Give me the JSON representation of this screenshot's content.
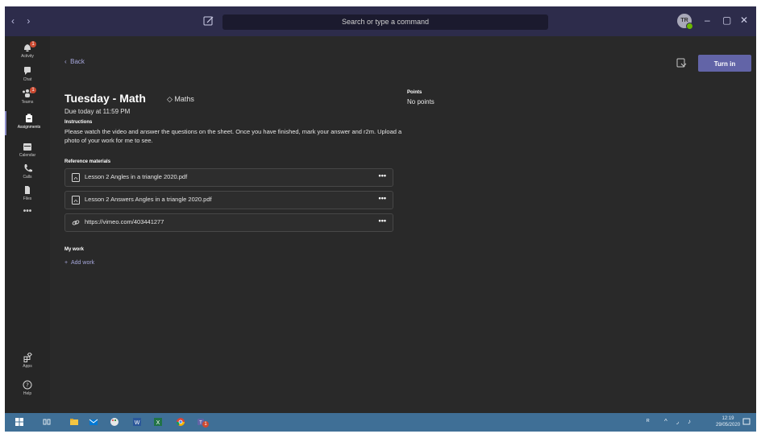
{
  "titlebar": {
    "nav_arrows": "‹ ›",
    "search_placeholder": "Search or type a command",
    "avatar_initials": "TR",
    "minimize": "–",
    "maximize": "▢",
    "close": "✕"
  },
  "rail": {
    "items": [
      {
        "label": "Activity",
        "icon": "bell-icon",
        "badge": "1"
      },
      {
        "label": "Chat",
        "icon": "chat-icon"
      },
      {
        "label": "Teams",
        "icon": "teams-icon",
        "badge": "1"
      },
      {
        "label": "Assignments",
        "icon": "assignments-icon",
        "active": true
      },
      {
        "label": "Calendar",
        "icon": "calendar-icon"
      },
      {
        "label": "Calls",
        "icon": "phone-icon"
      },
      {
        "label": "Files",
        "icon": "files-icon"
      }
    ],
    "more": "•••",
    "apps_label": "Apps",
    "help_label": "Help"
  },
  "assignment": {
    "back_label": "Back",
    "turn_in_label": "Turn in",
    "title": "Tuesday - Math",
    "tag": "Maths",
    "due": "Due today at 11:59 PM",
    "instructions_heading": "Instructions",
    "instructions_text": "Please watch the video and answer the questions on the sheet. Once you have finished, mark your answer and r2m. Upload a photo of your work for me to see.",
    "reference_heading": "Reference materials",
    "references": [
      {
        "name": "Lesson 2 Angles in a triangle 2020.pdf",
        "icon": "pdf-icon"
      },
      {
        "name": "Lesson 2 Answers Angles in a triangle 2020.pdf",
        "icon": "pdf-icon"
      },
      {
        "name": "https://vimeo.com/403441277",
        "icon": "link-icon"
      }
    ],
    "more_label": "•••",
    "points_heading": "Points",
    "points_value": "No points",
    "my_work_heading": "My work",
    "add_work_label": "Add work"
  },
  "taskbar": {
    "time": "12:19",
    "date": "29/05/2020",
    "teams_badge": "1"
  },
  "colors": {
    "accent": "#6264a7",
    "titlebar": "#2d2c4b",
    "taskbar": "#3f6f96",
    "background": "#292929",
    "badge": "#cc4a31"
  }
}
